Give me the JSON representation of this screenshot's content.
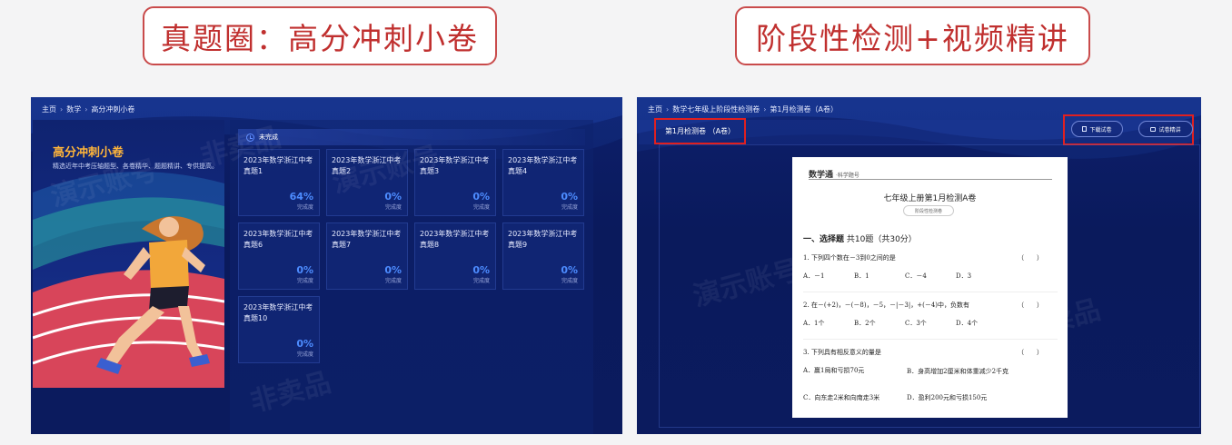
{
  "labels": {
    "left": "真题圈：高分冲刺小卷",
    "right": "阶段性检测+视频精讲"
  },
  "left_panel": {
    "breadcrumb": [
      "主页",
      "数学",
      "高分冲刺小卷"
    ],
    "hero": {
      "title": "高分冲刺小卷",
      "description": "精选近年中考压轴题型、各卷精华、题题精讲、专供提高。"
    },
    "status": "未完成",
    "cards": [
      {
        "title": "2023年数学浙江中考真题1",
        "percent": "64%",
        "label": "完成度"
      },
      {
        "title": "2023年数学浙江中考真题2",
        "percent": "0%",
        "label": "完成度"
      },
      {
        "title": "2023年数学浙江中考真题3",
        "percent": "0%",
        "label": "完成度"
      },
      {
        "title": "2023年数学浙江中考真题4",
        "percent": "0%",
        "label": "完成度"
      },
      {
        "title": "2023年数学浙江中考真题6",
        "percent": "0%",
        "label": "完成度"
      },
      {
        "title": "2023年数学浙江中考真题7",
        "percent": "0%",
        "label": "完成度"
      },
      {
        "title": "2023年数学浙江中考真题8",
        "percent": "0%",
        "label": "完成度"
      },
      {
        "title": "2023年数学浙江中考真题9",
        "percent": "0%",
        "label": "完成度"
      },
      {
        "title": "2023年数学浙江中考真题10",
        "percent": "0%",
        "label": "完成度"
      }
    ],
    "watermarks": [
      "演示账号",
      "非卖品",
      "演示账号",
      "非卖品"
    ]
  },
  "right_panel": {
    "breadcrumb": [
      "主页",
      "数学七年级上阶段性检测卷",
      "第1月检测卷（A卷）"
    ],
    "active_tab": "第1月检测卷 （A卷）",
    "download_label": "下载试卷",
    "explain_label": "试卷精讲",
    "paper": {
      "logo": "数学通",
      "logo_sub": "·科学题号",
      "title": "七年级上册第1月检测A卷",
      "tag": "阶段性检测卷",
      "section_title": "一、选择题",
      "section_detail": "共10题（共30分）",
      "paren": "（　　）",
      "questions": [
        {
          "text": "1. 下列四个数在－3到0之间的是",
          "options": [
            "A．－1",
            "B．1",
            "C．－4",
            "D．3"
          ]
        },
        {
          "text": "2. 在－(+2)，－(－8)，－5，－|－3|，+(－4)中，负数有",
          "options": [
            "A．1个",
            "B．2个",
            "C．3个",
            "D．4个"
          ]
        },
        {
          "text": "3. 下列具有相反意义的量是",
          "options": [
            "A．赢1局和亏损70元",
            "B．身高增加2厘米和体重减少2千克",
            "C．向东走2米和向南走3米",
            "D．盈利200元和亏损150元"
          ]
        }
      ]
    },
    "watermarks": [
      "演示账号",
      "非卖品"
    ]
  },
  "colors": {
    "accent_red": "#c0302f",
    "progress_blue": "#4d8cff",
    "panel_navy": "#0a1a5c",
    "hero_orange": "#ffb53a"
  }
}
